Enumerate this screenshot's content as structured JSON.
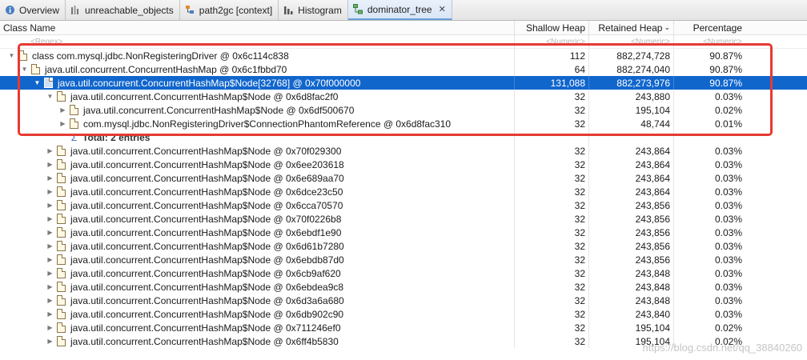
{
  "tabs": [
    {
      "label": "Overview",
      "icon": "info-icon"
    },
    {
      "label": "unreachable_objects",
      "icon": "bar-chart-icon"
    },
    {
      "label": "path2gc [context]",
      "icon": "path-tree-icon"
    },
    {
      "label": "Histogram",
      "icon": "histogram-icon"
    },
    {
      "label": "dominator_tree",
      "icon": "dominator-tree-icon",
      "close": "✕"
    }
  ],
  "header": {
    "class_name": "Class Name",
    "shallow_heap": "Shallow Heap",
    "retained_heap": "Retained Heap",
    "percentage": "Percentage",
    "sort_indicator": "⌄"
  },
  "filter": {
    "class_name": "<Regex>",
    "shallow_heap": "<Numeric>",
    "retained_heap": "<Numeric>",
    "percentage": "<Numeric>"
  },
  "rows": [
    {
      "name": "class com.mysql.jdbc.NonRegisteringDriver @ 0x6c114c838",
      "shallow": "112",
      "retained": "882,274,728",
      "pct": "90.87%"
    },
    {
      "name": "java.util.concurrent.ConcurrentHashMap @ 0x6c1fbbd70",
      "shallow": "64",
      "retained": "882,274,040",
      "pct": "90.87%"
    },
    {
      "name": "java.util.concurrent.ConcurrentHashMap$Node[32768] @ 0x70f000000",
      "shallow": "131,088",
      "retained": "882,273,976",
      "pct": "90.87%"
    },
    {
      "name": "java.util.concurrent.ConcurrentHashMap$Node @ 0x6d8fac2f0",
      "shallow": "32",
      "retained": "243,880",
      "pct": "0.03%"
    },
    {
      "name": "java.util.concurrent.ConcurrentHashMap$Node @ 0x6df500670",
      "shallow": "32",
      "retained": "195,104",
      "pct": "0.02%"
    },
    {
      "name": "com.mysql.jdbc.NonRegisteringDriver$ConnectionPhantomReference @ 0x6d8fac310",
      "shallow": "32",
      "retained": "48,744",
      "pct": "0.01%"
    },
    {
      "name": "Total: 2 entries",
      "shallow": "",
      "retained": "",
      "pct": ""
    },
    {
      "name": "java.util.concurrent.ConcurrentHashMap$Node @ 0x70f029300",
      "shallow": "32",
      "retained": "243,864",
      "pct": "0.03%"
    },
    {
      "name": "java.util.concurrent.ConcurrentHashMap$Node @ 0x6ee203618",
      "shallow": "32",
      "retained": "243,864",
      "pct": "0.03%"
    },
    {
      "name": "java.util.concurrent.ConcurrentHashMap$Node @ 0x6e689aa70",
      "shallow": "32",
      "retained": "243,864",
      "pct": "0.03%"
    },
    {
      "name": "java.util.concurrent.ConcurrentHashMap$Node @ 0x6dce23c50",
      "shallow": "32",
      "retained": "243,864",
      "pct": "0.03%"
    },
    {
      "name": "java.util.concurrent.ConcurrentHashMap$Node @ 0x6cca70570",
      "shallow": "32",
      "retained": "243,856",
      "pct": "0.03%"
    },
    {
      "name": "java.util.concurrent.ConcurrentHashMap$Node @ 0x70f0226b8",
      "shallow": "32",
      "retained": "243,856",
      "pct": "0.03%"
    },
    {
      "name": "java.util.concurrent.ConcurrentHashMap$Node @ 0x6ebdf1e90",
      "shallow": "32",
      "retained": "243,856",
      "pct": "0.03%"
    },
    {
      "name": "java.util.concurrent.ConcurrentHashMap$Node @ 0x6d61b7280",
      "shallow": "32",
      "retained": "243,856",
      "pct": "0.03%"
    },
    {
      "name": "java.util.concurrent.ConcurrentHashMap$Node @ 0x6ebdb87d0",
      "shallow": "32",
      "retained": "243,856",
      "pct": "0.03%"
    },
    {
      "name": "java.util.concurrent.ConcurrentHashMap$Node @ 0x6cb9af620",
      "shallow": "32",
      "retained": "243,848",
      "pct": "0.03%"
    },
    {
      "name": "java.util.concurrent.ConcurrentHashMap$Node @ 0x6ebdea9c8",
      "shallow": "32",
      "retained": "243,848",
      "pct": "0.03%"
    },
    {
      "name": "java.util.concurrent.ConcurrentHashMap$Node @ 0x6d3a6a680",
      "shallow": "32",
      "retained": "243,848",
      "pct": "0.03%"
    },
    {
      "name": "java.util.concurrent.ConcurrentHashMap$Node @ 0x6db902c90",
      "shallow": "32",
      "retained": "243,840",
      "pct": "0.03%"
    },
    {
      "name": "java.util.concurrent.ConcurrentHashMap$Node @ 0x711246ef0",
      "shallow": "32",
      "retained": "195,104",
      "pct": "0.02%"
    },
    {
      "name": "java.util.concurrent.ConcurrentHashMap$Node @ 0x6ff4b5830",
      "shallow": "32",
      "retained": "195,104",
      "pct": "0.02%"
    }
  ],
  "watermark": "https://blog.csdn.net/qq_38840260",
  "colors": {
    "selection": "#1166cc",
    "annotation": "#e63a32",
    "tab_active": "#d9e6f6"
  }
}
